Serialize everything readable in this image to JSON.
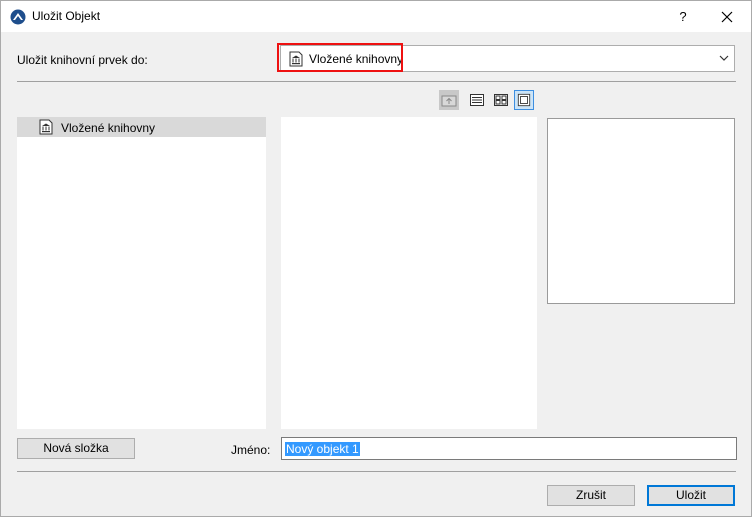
{
  "window": {
    "title": "Uložit Objekt",
    "help_label": "?"
  },
  "location": {
    "label": "Uložit knihovní prvek do:",
    "selected_value": "Vložené knihovny"
  },
  "tree": {
    "items": [
      {
        "label": "Vložené knihovny",
        "icon": "library-icon"
      }
    ]
  },
  "toolbar": {
    "buttons": [
      "folder-up-icon",
      "list-view-icon",
      "icon-view-icon",
      "preview-view-icon"
    ]
  },
  "bottom": {
    "new_folder_label": "Nová složka",
    "name_label": "Jméno:",
    "name_value": "Nový objekt 1"
  },
  "actions": {
    "cancel_label": "Zrušit",
    "save_label": "Uložit"
  },
  "colors": {
    "accent": "#0078d7",
    "highlight": "#e11111",
    "selection": "#3399ff"
  }
}
